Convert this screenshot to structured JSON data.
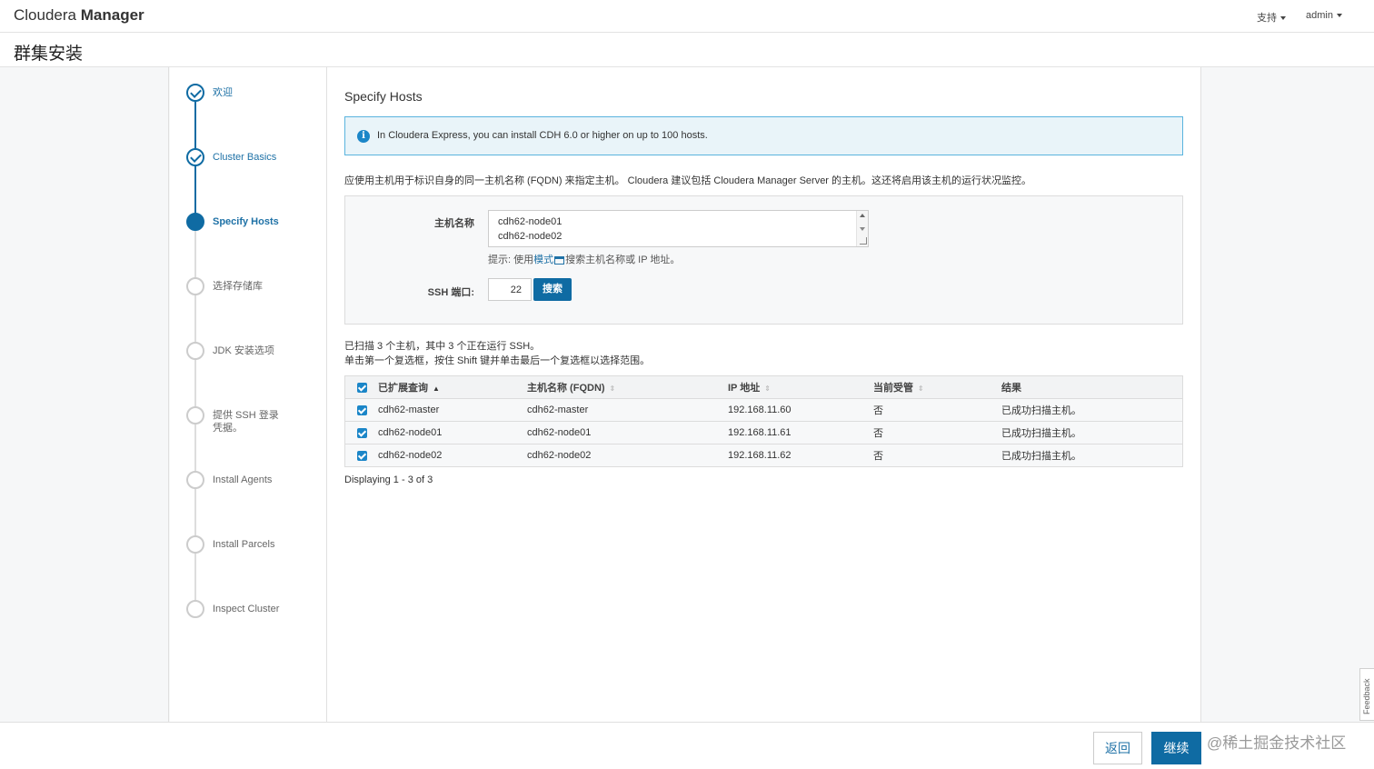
{
  "app": {
    "brand_light": "Cloudera",
    "brand_bold": "Manager",
    "nav_support": "支持",
    "nav_user": "admin"
  },
  "page_title": "群集安装",
  "steps": [
    {
      "label": "欢迎",
      "state": "done"
    },
    {
      "label": "Cluster Basics",
      "state": "done"
    },
    {
      "label": "Specify Hosts",
      "state": "active"
    },
    {
      "label": "选择存储库",
      "state": "pending"
    },
    {
      "label": "JDK 安装选项",
      "state": "pending"
    },
    {
      "label": "提供 SSH 登录凭据。",
      "state": "pending"
    },
    {
      "label": "Install Agents",
      "state": "pending"
    },
    {
      "label": "Install Parcels",
      "state": "pending"
    },
    {
      "label": "Inspect Cluster",
      "state": "pending"
    }
  ],
  "main": {
    "section_title": "Specify Hosts",
    "alert_text": "In Cloudera Express, you can install CDH 6.0 or higher on up to 100 hosts.",
    "description": "应使用主机用于标识自身的同一主机名称 (FQDN) 来指定主机。 Cloudera 建议包括 Cloudera Manager Server 的主机。这还将启用该主机的运行状况监控。",
    "hostname_label": "主机名称",
    "hostname_lines": [
      "cdh62-node01",
      "cdh62-node02"
    ],
    "hint_prefix": "提示: 使用",
    "hint_link": "模式",
    "hint_suffix": "搜索主机名称或 IP 地址。",
    "ssh_port_label": "SSH 端口:",
    "ssh_port_value": "22",
    "search_button": "搜索",
    "scan_line1": "已扫描 3 个主机，其中 3 个正在运行 SSH。",
    "scan_line2": "单击第一个复选框，按住 Shift 键并单击最后一个复选框以选择范围。",
    "table": {
      "headers": [
        "已扩展查询",
        "主机名称 (FQDN)",
        "IP 地址",
        "当前受管",
        "结果"
      ],
      "rows": [
        {
          "expanded": "cdh62-master",
          "fqdn": "cdh62-master",
          "ip": "192.168.11.60",
          "managed": "否",
          "result": "已成功扫描主机。"
        },
        {
          "expanded": "cdh62-node01",
          "fqdn": "cdh62-node01",
          "ip": "192.168.11.61",
          "managed": "否",
          "result": "已成功扫描主机。"
        },
        {
          "expanded": "cdh62-node02",
          "fqdn": "cdh62-node02",
          "ip": "192.168.11.62",
          "managed": "否",
          "result": "已成功扫描主机。"
        }
      ]
    },
    "displaying": "Displaying 1 - 3 of 3"
  },
  "footer": {
    "back_button": "返回",
    "next_button": "继续",
    "watermark": "@稀土掘金技术社区"
  },
  "feedback_tab": "Feedback",
  "colors": {
    "accent": "#0f6ba3",
    "link": "#1e71a6",
    "alert_bg": "#e9f4f9",
    "alert_border": "#5ab4de"
  }
}
